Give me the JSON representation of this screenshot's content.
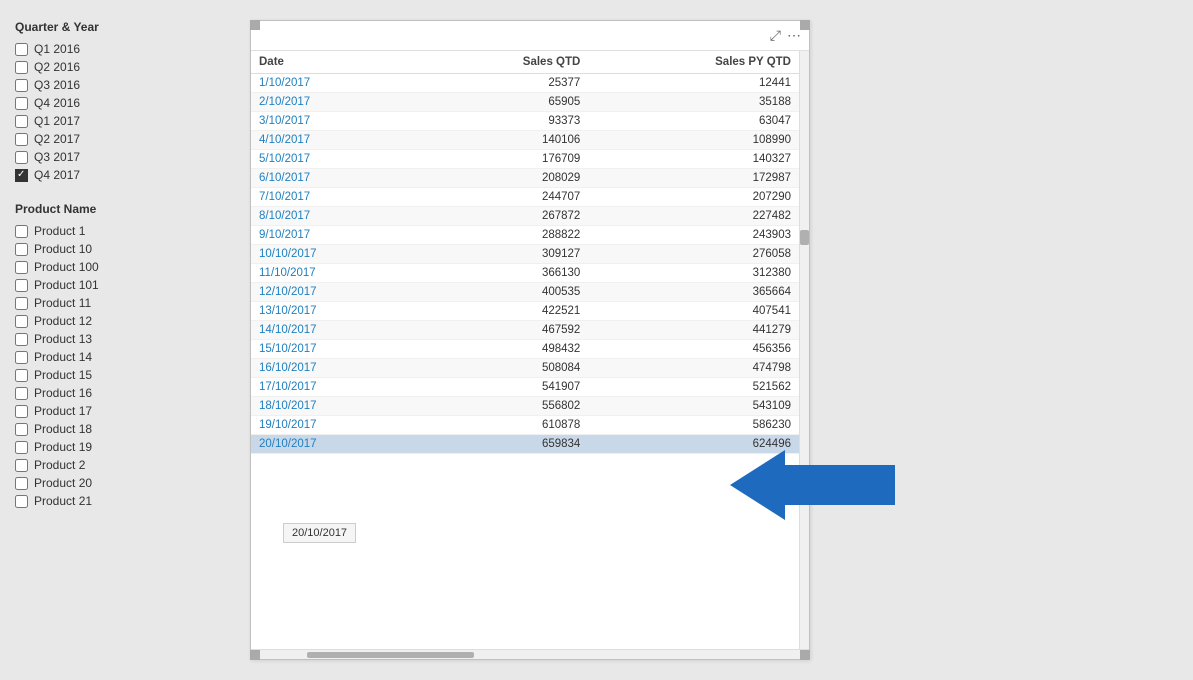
{
  "leftPanel": {
    "quarterSection": {
      "title": "Quarter & Year",
      "items": [
        {
          "label": "Q1 2016",
          "checked": false
        },
        {
          "label": "Q2 2016",
          "checked": false
        },
        {
          "label": "Q3 2016",
          "checked": false
        },
        {
          "label": "Q4 2016",
          "checked": false
        },
        {
          "label": "Q1 2017",
          "checked": false
        },
        {
          "label": "Q2 2017",
          "checked": false
        },
        {
          "label": "Q3 2017",
          "checked": false
        },
        {
          "label": "Q4 2017",
          "checked": true
        }
      ]
    },
    "productSection": {
      "title": "Product Name",
      "items": [
        {
          "label": "Product 1"
        },
        {
          "label": "Product 10"
        },
        {
          "label": "Product 100"
        },
        {
          "label": "Product 101"
        },
        {
          "label": "Product 11"
        },
        {
          "label": "Product 12"
        },
        {
          "label": "Product 13"
        },
        {
          "label": "Product 14"
        },
        {
          "label": "Product 15"
        },
        {
          "label": "Product 16"
        },
        {
          "label": "Product 17"
        },
        {
          "label": "Product 18"
        },
        {
          "label": "Product 19"
        },
        {
          "label": "Product 2"
        },
        {
          "label": "Product 20"
        },
        {
          "label": "Product 21"
        }
      ]
    }
  },
  "table": {
    "columns": [
      "Date",
      "Sales QTD",
      "Sales PY QTD"
    ],
    "rows": [
      {
        "date": "1/10/2017",
        "salesQTD": "25377",
        "salesPYQTD": "12441",
        "highlighted": false
      },
      {
        "date": "2/10/2017",
        "salesQTD": "65905",
        "salesPYQTD": "35188",
        "highlighted": false
      },
      {
        "date": "3/10/2017",
        "salesQTD": "93373",
        "salesPYQTD": "63047",
        "highlighted": false
      },
      {
        "date": "4/10/2017",
        "salesQTD": "140106",
        "salesPYQTD": "108990",
        "highlighted": false
      },
      {
        "date": "5/10/2017",
        "salesQTD": "176709",
        "salesPYQTD": "140327",
        "highlighted": false
      },
      {
        "date": "6/10/2017",
        "salesQTD": "208029",
        "salesPYQTD": "172987",
        "highlighted": false
      },
      {
        "date": "7/10/2017",
        "salesQTD": "244707",
        "salesPYQTD": "207290",
        "highlighted": false
      },
      {
        "date": "8/10/2017",
        "salesQTD": "267872",
        "salesPYQTD": "227482",
        "highlighted": false
      },
      {
        "date": "9/10/2017",
        "salesQTD": "288822",
        "salesPYQTD": "243903",
        "highlighted": false
      },
      {
        "date": "10/10/2017",
        "salesQTD": "309127",
        "salesPYQTD": "276058",
        "highlighted": false
      },
      {
        "date": "11/10/2017",
        "salesQTD": "366130",
        "salesPYQTD": "312380",
        "highlighted": false
      },
      {
        "date": "12/10/2017",
        "salesQTD": "400535",
        "salesPYQTD": "365664",
        "highlighted": false
      },
      {
        "date": "13/10/2017",
        "salesQTD": "422521",
        "salesPYQTD": "407541",
        "highlighted": false
      },
      {
        "date": "14/10/2017",
        "salesQTD": "467592",
        "salesPYQTD": "441279",
        "highlighted": false
      },
      {
        "date": "15/10/2017",
        "salesQTD": "498432",
        "salesPYQTD": "456356",
        "highlighted": false
      },
      {
        "date": "16/10/2017",
        "salesQTD": "508084",
        "salesPYQTD": "474798",
        "highlighted": false
      },
      {
        "date": "17/10/2017",
        "salesQTD": "541907",
        "salesPYQTD": "521562",
        "highlighted": false
      },
      {
        "date": "18/10/2017",
        "salesQTD": "556802",
        "salesPYQTD": "543109",
        "highlighted": false
      },
      {
        "date": "19/10/2017",
        "salesQTD": "610878",
        "salesPYQTD": "586230",
        "highlighted": false
      },
      {
        "date": "20/10/2017",
        "salesQTD": "659834",
        "salesPYQTD": "624496",
        "highlighted": true
      }
    ],
    "tooltip": "20/10/2017"
  },
  "topBarIcons": {
    "expand": "⤢",
    "menu": "⋯"
  }
}
